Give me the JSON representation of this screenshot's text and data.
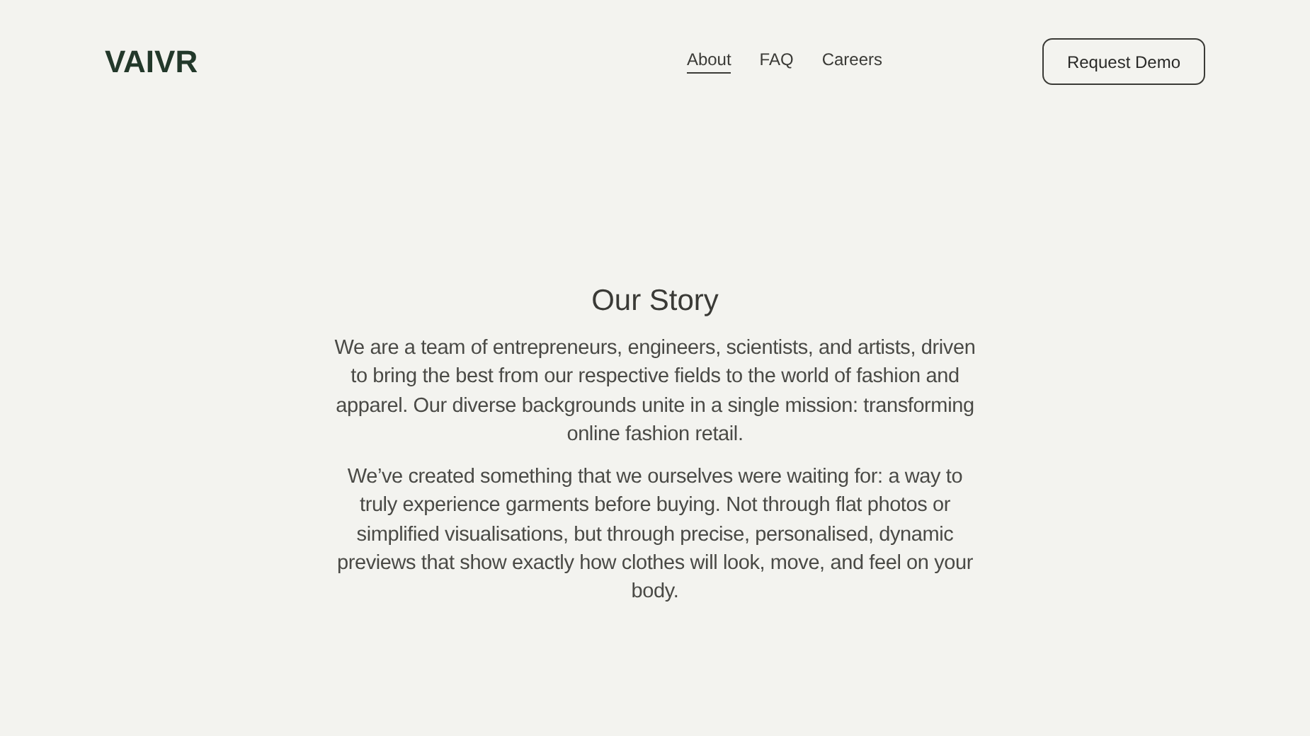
{
  "header": {
    "logo": "VAIVR",
    "nav": [
      {
        "label": "About",
        "selected": true
      },
      {
        "label": "FAQ",
        "selected": false
      },
      {
        "label": "Careers",
        "selected": false
      }
    ],
    "cta": "Request Demo"
  },
  "story": {
    "title": "Our Story",
    "paragraphs": [
      "We are a team of entrepreneurs, engineers, scientists, and artists, driven to bring the best from our respective fields to the world of fashion and apparel. Our diverse backgrounds unite in a single mission: transforming online fashion retail.",
      "We’ve created something that we ourselves were waiting for: a way to truly experience garments before buying. Not through flat photos or simplified visualisations, but through precise, personalised, dynamic previews that show exactly how clothes will look, move, and feel on your body."
    ]
  }
}
